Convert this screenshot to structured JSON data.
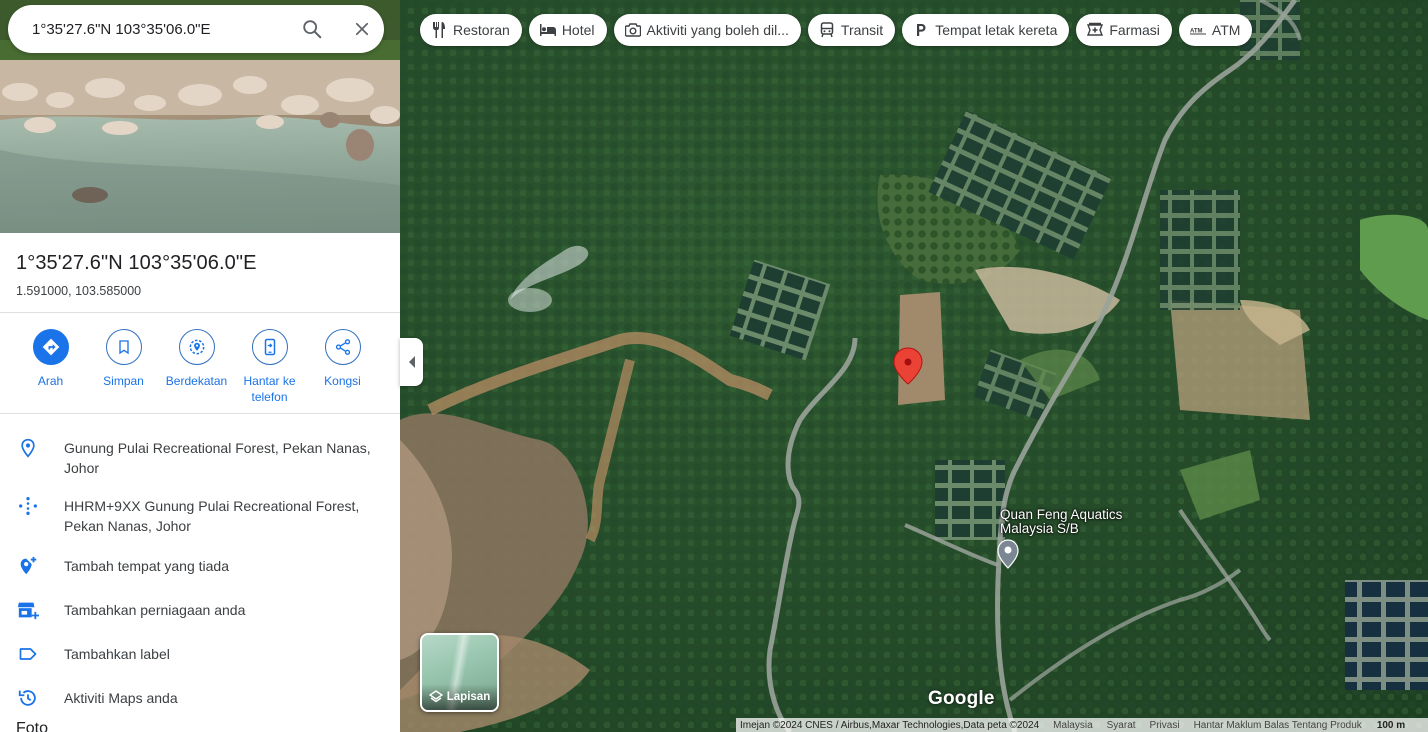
{
  "search": {
    "value": "1°35'27.6\"N 103°35'06.0\"E",
    "search_icon": "search-icon",
    "close_icon": "close-icon"
  },
  "place": {
    "title": "1°35'27.6\"N 103°35'06.0\"E",
    "decimal_coords": "1.591000, 103.585000"
  },
  "actions": [
    {
      "label": "Arah",
      "icon": "directions-icon"
    },
    {
      "label": "Simpan",
      "icon": "bookmark-icon"
    },
    {
      "label": "Berdekatan",
      "icon": "nearby-icon"
    },
    {
      "label": "Hantar ke telefon",
      "icon": "send-to-phone-icon"
    },
    {
      "label": "Kongsi",
      "icon": "share-icon"
    }
  ],
  "info": [
    {
      "text": "Gunung Pulai Recreational Forest, Pekan Nanas, Johor",
      "icon": "location-pin-icon"
    },
    {
      "text": "HHRM+9XX Gunung Pulai Recreational Forest, Pekan Nanas, Johor",
      "icon": "plus-code-icon"
    },
    {
      "text": "Tambah tempat yang tiada",
      "icon": "add-place-icon"
    },
    {
      "text": "Tambahkan perniagaan anda",
      "icon": "add-business-icon"
    },
    {
      "text": "Tambahkan label",
      "icon": "label-icon"
    },
    {
      "text": "Aktiviti Maps anda",
      "icon": "history-icon"
    }
  ],
  "photos_heading": "Foto",
  "chips": [
    {
      "label": "Restoran",
      "icon": "restaurant-icon"
    },
    {
      "label": "Hotel",
      "icon": "hotel-icon"
    },
    {
      "label": "Aktiviti yang boleh dil...",
      "icon": "camera-icon"
    },
    {
      "label": "Transit",
      "icon": "transit-icon"
    },
    {
      "label": "Tempat letak kereta",
      "icon": "parking-icon"
    },
    {
      "label": "Farmasi",
      "icon": "pharmacy-icon"
    },
    {
      "label": "ATM",
      "icon": "atm-icon"
    }
  ],
  "map": {
    "poi_label_line1": "Quan Feng Aquatics",
    "poi_label_line2": "Malaysia S/B",
    "layers_label": "Lapisan",
    "logo": "Google",
    "footer": {
      "attribution": "Imejan ©2024 CNES / Airbus,Maxar Technologies,Data peta ©2024",
      "links": [
        "Malaysia",
        "Syarat",
        "Privasi",
        "Hantar Maklum Balas Tentang Produk"
      ],
      "scale": "100 m"
    },
    "colors": {
      "pin": "#ea4335",
      "accent": "#1a73e8"
    }
  }
}
